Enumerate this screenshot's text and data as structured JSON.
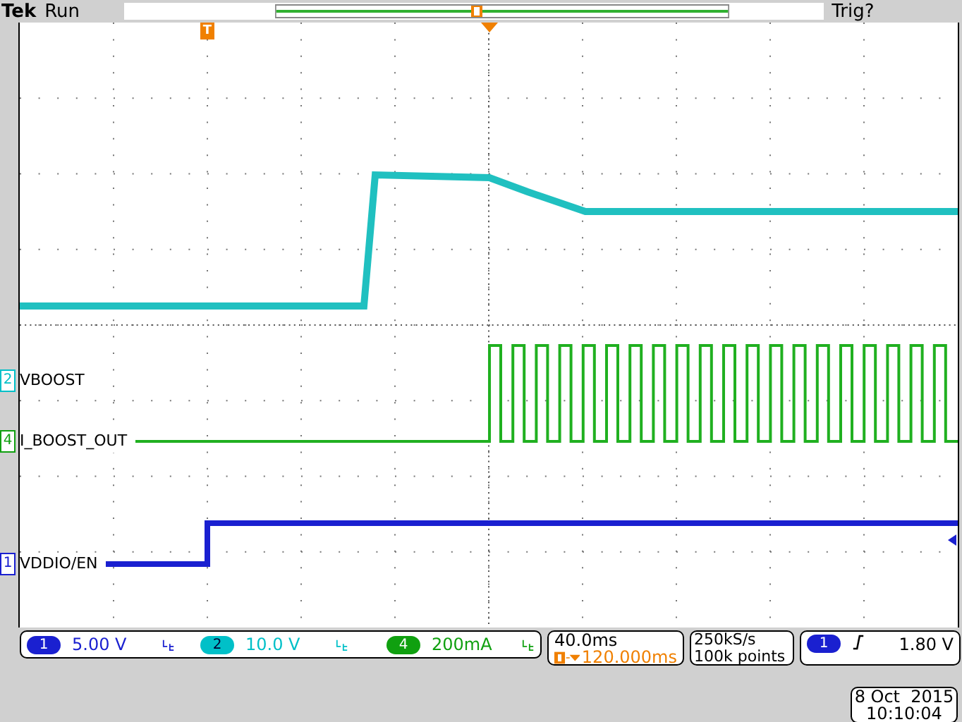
{
  "status": {
    "brand": "Tek",
    "state": "Run",
    "trigger_status": "Trig?"
  },
  "plot": {
    "trigger_position_marker": "T"
  },
  "channels": [
    {
      "number": "2",
      "label": "VBOOST",
      "color": "#00c0c8"
    },
    {
      "number": "4",
      "label": "I_BOOST_OUT",
      "color": "#10a010"
    },
    {
      "number": "1",
      "label": "VDDIO/EN",
      "color": "#1a20d0"
    }
  ],
  "readouts": [
    {
      "number": "1",
      "scale": "5.00 V",
      "color": "#1a20d0"
    },
    {
      "number": "2",
      "scale": "10.0 V",
      "color": "#00c0c8"
    },
    {
      "number": "4",
      "scale": "200mA",
      "color": "#10a010"
    }
  ],
  "horizontal": {
    "scale": "40.0ms",
    "delay": "120.000ms"
  },
  "acquisition": {
    "rate": "250kS/s",
    "points": "100k points"
  },
  "trigger": {
    "source": "1",
    "level": "1.80 V"
  },
  "timestamp": {
    "date": "8 Oct  2015",
    "time": "10:10:04"
  }
}
